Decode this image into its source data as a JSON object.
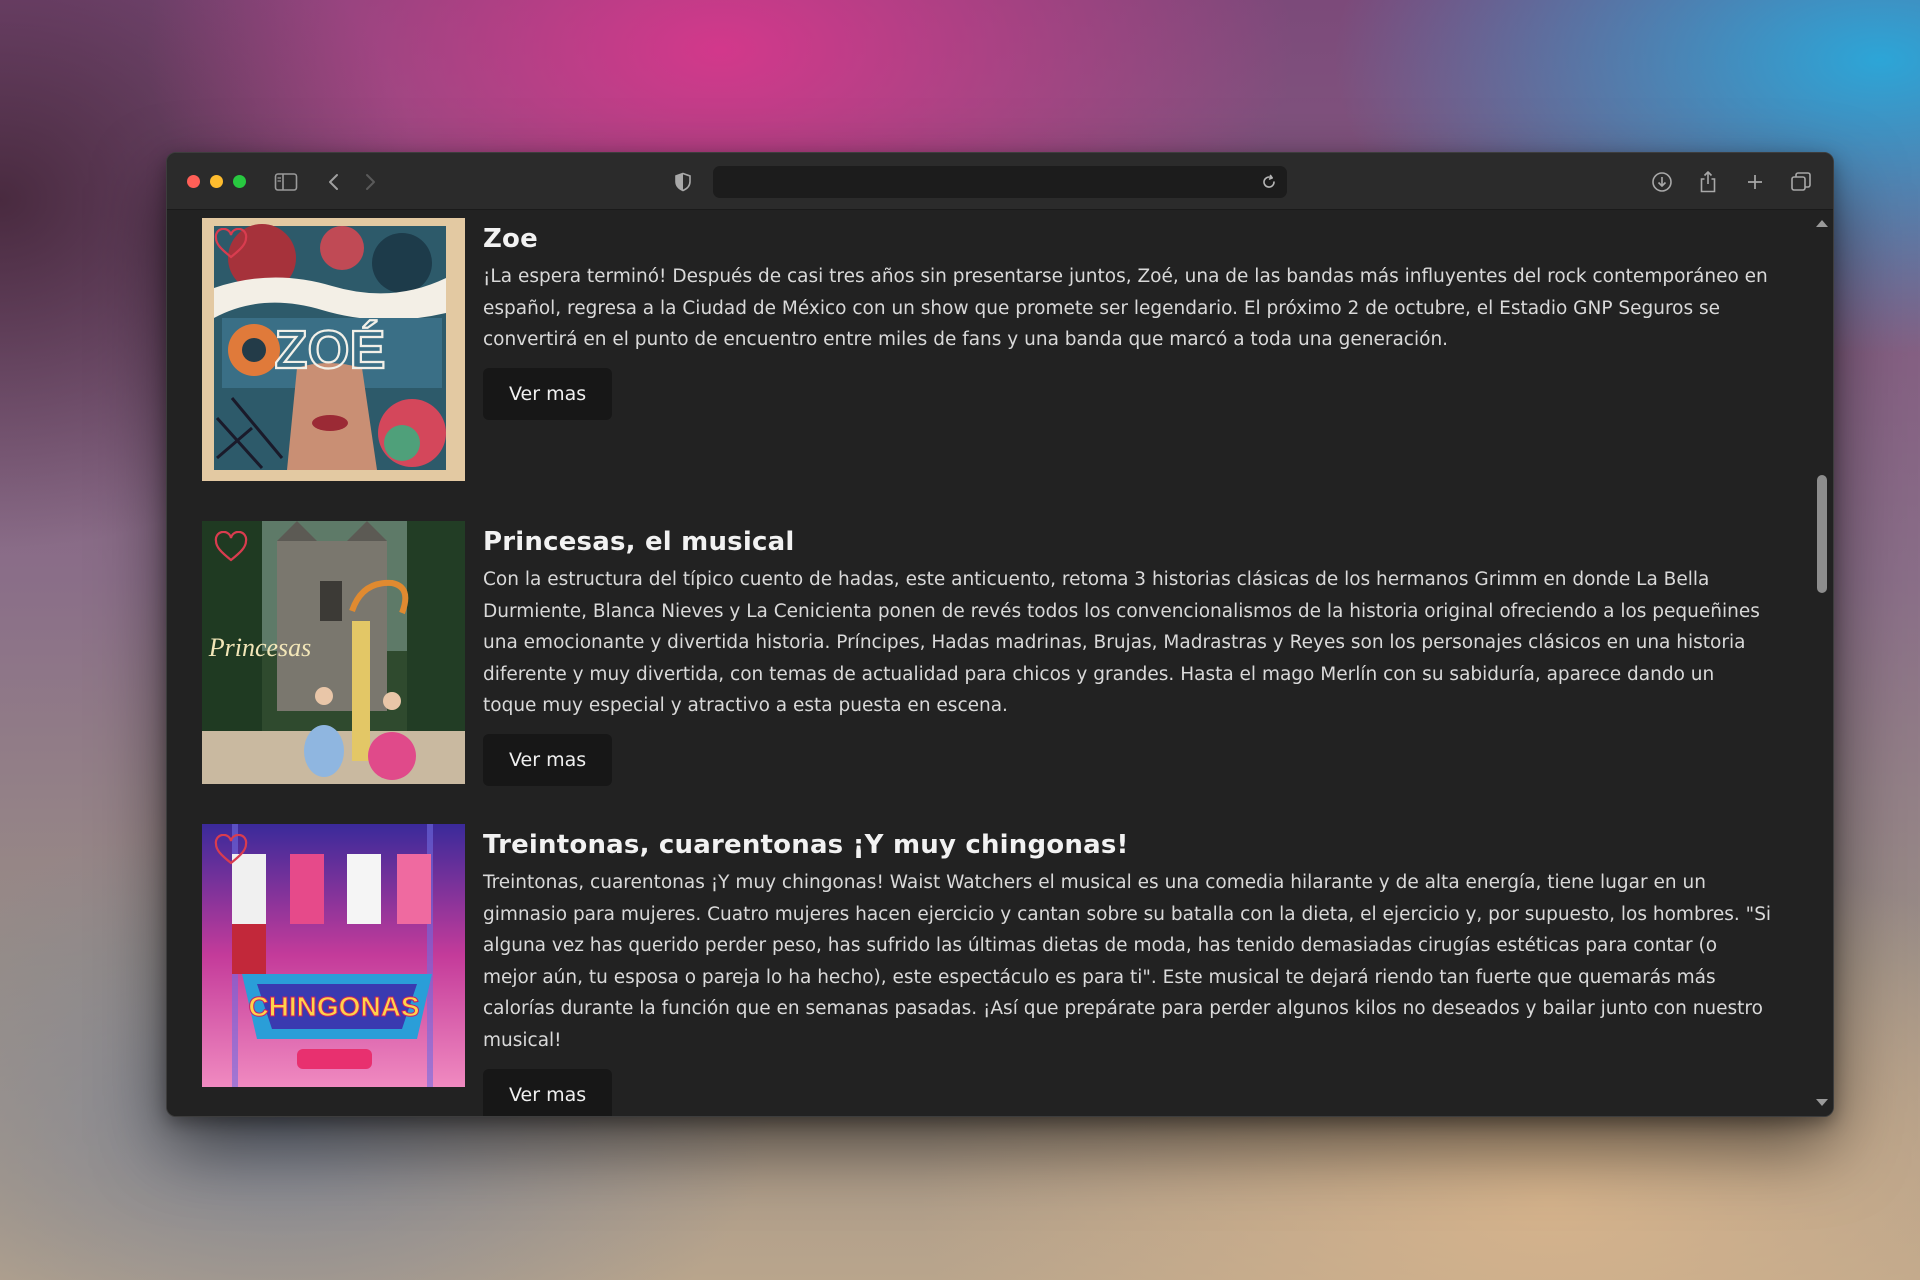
{
  "browser": {
    "url": "",
    "icons": [
      "sidebar-icon",
      "back-icon",
      "forward-icon",
      "shield-icon",
      "reload-icon",
      "download-icon",
      "share-icon",
      "new-tab-icon",
      "tabs-overview-icon"
    ]
  },
  "events": [
    {
      "title": "Zoe",
      "description": "¡La espera terminó! Después de casi tres años sin presentarse juntos, Zoé, una de las bandas más influyentes del rock contemporáneo en español, regresa a la Ciudad de México con un show que promete ser legendario. El próximo 2 de octubre, el Estadio GNP Seguros se convertirá en el punto de encuentro entre miles de fans y una banda que marcó a toda una generación.",
      "button": "Ver mas",
      "poster_text": "ZOÉ"
    },
    {
      "title": "Princesas, el musical",
      "description": "Con la estructura del típico cuento de hadas, este anticuento, retoma 3 historias clásicas de los hermanos Grimm en donde La Bella Durmiente, Blanca Nieves y La Cenicienta ponen de revés todos los convencionalismos de la historia original ofreciendo a los pequeñines una emocionante y divertida historia. Príncipes, Hadas madrinas, Brujas, Madrastras y Reyes son los personajes clásicos en una historia diferente y muy divertida, con temas de actualidad para chicos y grandes. Hasta el mago Merlín con su sabiduría, aparece dando un toque muy especial y atractivo a esta puesta en escena.",
      "button": "Ver mas",
      "poster_text": "Princesas"
    },
    {
      "title": "Treintonas, cuarentonas ¡Y muy chingonas!",
      "description": "Treintonas, cuarentonas ¡Y muy chingonas! Waist Watchers el musical es una comedia hilarante y de alta energía, tiene lugar en un gimnasio para mujeres. Cuatro mujeres hacen ejercicio y cantan sobre su batalla con la dieta, el ejercicio y, por supuesto, los hombres. \"Si alguna vez has querido perder peso, has sufrido las últimas dietas de moda, has tenido demasiadas cirugías estéticas para contar (o mejor aún, tu esposa o pareja lo ha hecho), este espectáculo es para ti\". Este musical te dejará riendo tan fuerte que quemarás más calorías durante la función que en semanas pasadas. ¡Así que prepárate para perder algunos kilos no deseados y bailar junto con nuestro musical!",
      "button": "Ver mas",
      "poster_text": "CHINGONAS"
    }
  ]
}
